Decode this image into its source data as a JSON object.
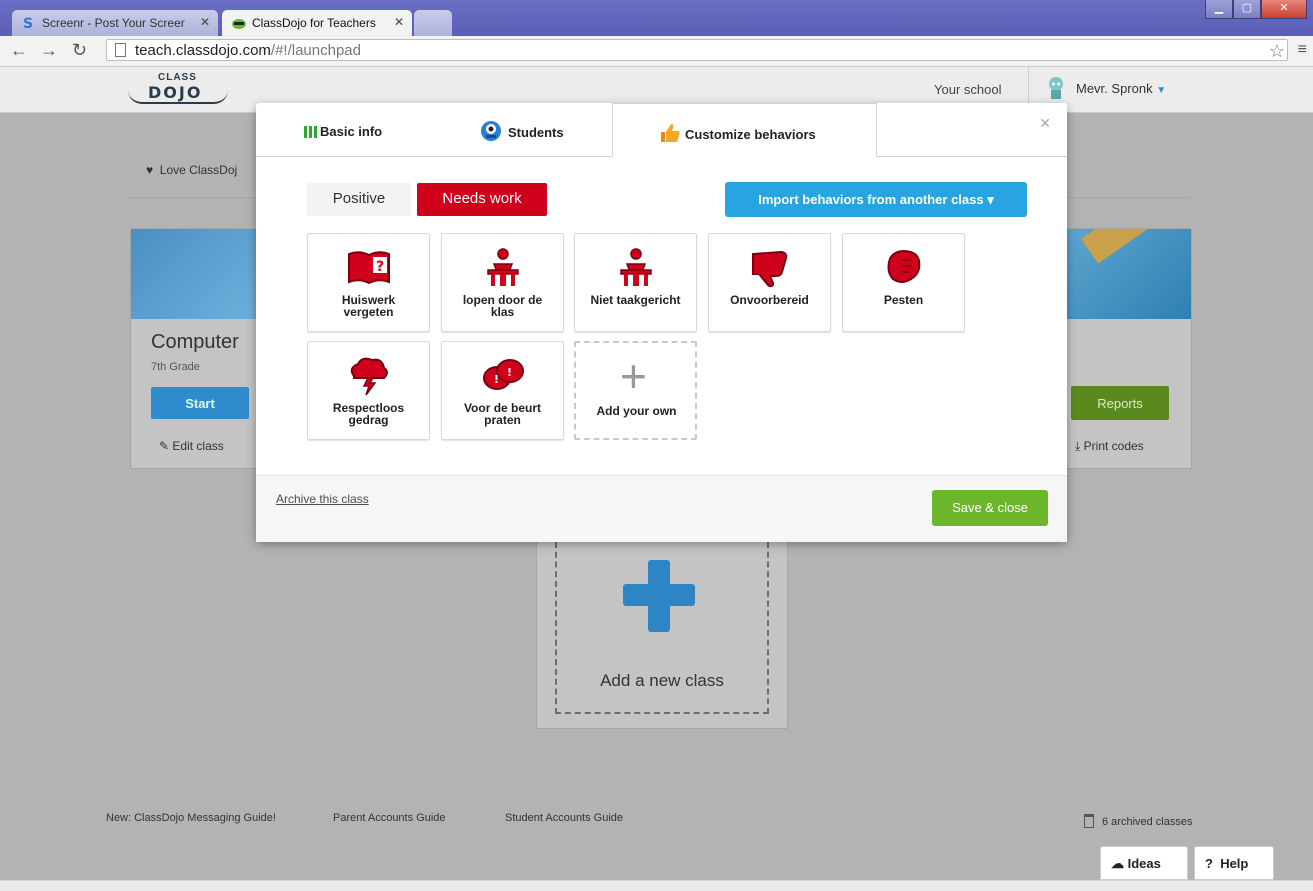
{
  "browser": {
    "tabs": [
      {
        "label": "Screenr - Post Your Screer"
      },
      {
        "label": "ClassDojo for Teachers"
      }
    ],
    "url_host": "teach.classdojo.com",
    "url_path": "/#!/launchpad"
  },
  "header": {
    "logo_top": "CLASS",
    "logo_bottom": "DOJO",
    "school": "Your school",
    "teacher": "Mevr. Spronk"
  },
  "background": {
    "love": "Love ClassDoj",
    "class_card": {
      "name": "Computer",
      "grade": "7th Grade",
      "start": "Start",
      "edit": "Edit class"
    },
    "right_card": {
      "reports": "Reports",
      "print": "Print codes"
    },
    "add_class": "Add a new class"
  },
  "modal": {
    "tabs": [
      "Basic info",
      "Students",
      "Customize behaviors"
    ],
    "positive": "Positive",
    "needs_work": "Needs work",
    "import": "Import behaviors from another class",
    "behaviors": [
      {
        "line1": "Huiswerk",
        "line2": "vergeten",
        "icon": "book-question-icon"
      },
      {
        "line1": "lopen door de",
        "line2": "klas",
        "icon": "student-desk-icon"
      },
      {
        "line1": "Niet taakgericht",
        "line2": "",
        "icon": "student-desk-icon"
      },
      {
        "line1": "Onvoorbereid",
        "line2": "",
        "icon": "thumbs-down-icon"
      },
      {
        "line1": "Pesten",
        "line2": "",
        "icon": "fist-icon"
      },
      {
        "line1": "Respectloos",
        "line2": "gedrag",
        "icon": "storm-cloud-icon"
      },
      {
        "line1": "Voor de beurt",
        "line2": "praten",
        "icon": "speech-bubbles-icon"
      }
    ],
    "add_own": "Add your own",
    "archive": "Archive this class",
    "save": "Save & close",
    "accent_red": "#d0021b",
    "accent_blue": "#28a4e0",
    "accent_green": "#6cb62b"
  },
  "footer": {
    "links": [
      "New: ClassDojo Messaging Guide!",
      "Parent Accounts Guide",
      "Student Accounts Guide"
    ],
    "archived": "6 archived classes",
    "ideas": "Ideas",
    "help": "Help"
  }
}
